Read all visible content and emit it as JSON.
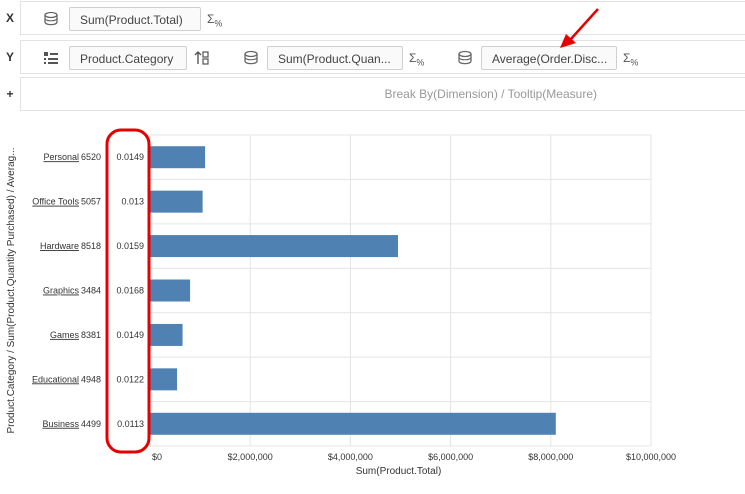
{
  "shelves": {
    "x": {
      "letter": "X",
      "items": [
        {
          "label": "Sum(Product.Total)"
        }
      ]
    },
    "y": {
      "letter": "Y",
      "items": [
        {
          "label": "Product.Category"
        },
        {
          "label": "Sum(Product.Quan..."
        },
        {
          "label": "Average(Order.Disc..."
        }
      ]
    },
    "plus": {
      "letter": "+",
      "placeholder": "Break By(Dimension) / Tooltip(Measure)"
    }
  },
  "icons": {
    "measure": "database-icon",
    "dimension": "list-icon",
    "sort": "sort-icon",
    "aggregate": "sigma-percent-icon"
  },
  "colors": {
    "bar": "#4f82b3",
    "highlight": "#e60000",
    "gridline": "#e4e4e4"
  },
  "chart_data": {
    "type": "bar",
    "orientation": "horizontal",
    "categories": [
      "Personal",
      "Office Tools",
      "Hardware",
      "Graphics",
      "Games",
      "Educational",
      "Business"
    ],
    "series": [
      {
        "name": "Sum(Product.Total)",
        "values": [
          1100000,
          1050000,
          4950000,
          800000,
          650000,
          540000,
          8100000
        ]
      }
    ],
    "row_values": {
      "quantity": [
        "6520",
        "5057",
        "8518",
        "3484",
        "8381",
        "4948",
        "4499"
      ],
      "discount": [
        "0.0149",
        "0.013",
        "0.0159",
        "0.0168",
        "0.0149",
        "0.0122",
        "0.0113"
      ]
    },
    "xticks": [
      "$0",
      "$2,000,000",
      "$4,000,000",
      "$6,000,000",
      "$8,000,000",
      "$10,000,000"
    ],
    "xlim": [
      0,
      10000000
    ],
    "xlabel": "Sum(Product.Total)",
    "ylabel": "Product.Category / Sum(Product.Quantity Purchased) / Averag...",
    "grid": true
  }
}
